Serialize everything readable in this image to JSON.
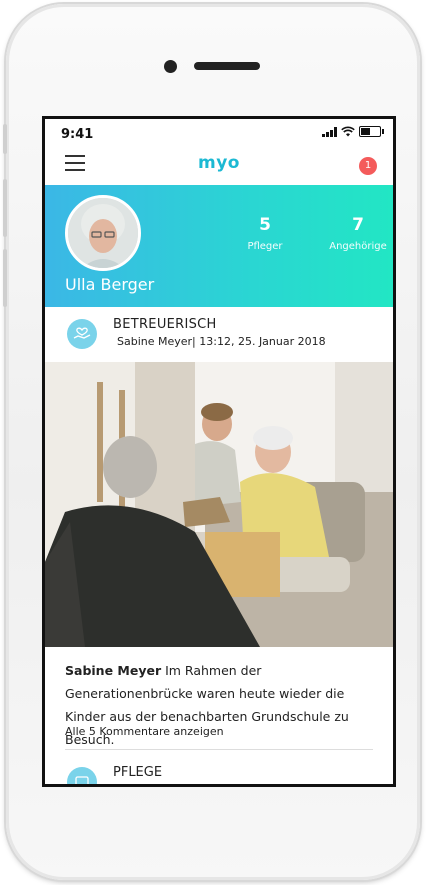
{
  "statusbar": {
    "time": "9:41"
  },
  "header": {
    "logo": "myo",
    "notification_count": "1"
  },
  "profile": {
    "name": "Ulla Berger",
    "stats": [
      {
        "value": "5",
        "label": "Pfleger"
      },
      {
        "value": "7",
        "label": "Angehörige"
      }
    ]
  },
  "post": {
    "category": "BETREUERISCH",
    "meta": "Sabine Meyer| 13:12, 25. Januar 2018",
    "author": "Sabine Meyer",
    "text": " Im Rahmen der Generationenbrücke waren heute wieder die Kinder aus der benachbarten Grundschule zu Besuch.",
    "comments_link": "Alle 5 Kommentare anzeigen"
  },
  "next_post": {
    "category": "PFLEGE"
  },
  "icons": [
    "menu-icon",
    "notification-badge",
    "heart-hand-icon",
    "care-icon"
  ],
  "colors": {
    "accent": "#1cb9d3",
    "gradient_start": "#3bb7e6",
    "gradient_end": "#22e6c4",
    "badge": "#f45b5b"
  }
}
